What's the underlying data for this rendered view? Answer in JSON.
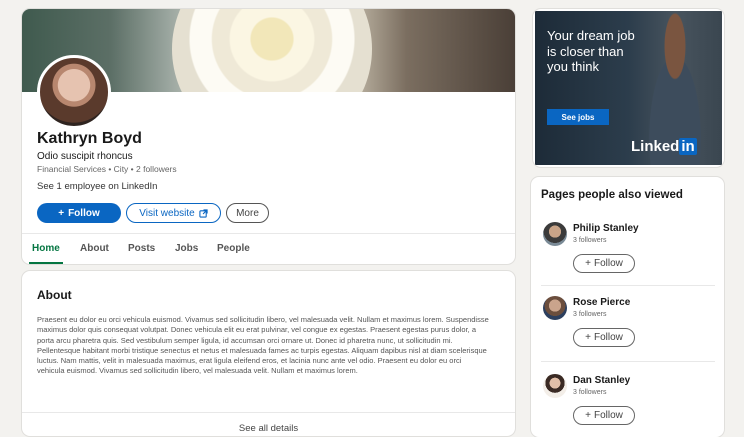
{
  "profile": {
    "name": "Kathryn Boyd",
    "headline": "Odio suscipit rhoncus",
    "meta": "Financial Services • City • 2 followers",
    "employees_link": "See 1 employee on LinkedIn",
    "follow_label": "Follow",
    "website_label": "Visit website",
    "more_label": "More"
  },
  "tabs": [
    {
      "label": "Home",
      "active": true
    },
    {
      "label": "About"
    },
    {
      "label": "Posts"
    },
    {
      "label": "Jobs"
    },
    {
      "label": "People"
    }
  ],
  "about": {
    "title": "About",
    "text": "Praesent eu dolor eu orci vehicula euismod. Vivamus sed sollicitudin libero, vel malesuada velit. Nullam et maximus lorem. Suspendisse maximus dolor quis consequat volutpat. Donec vehicula elit eu erat pulvinar, vel congue ex egestas. Praesent egestas purus dolor, a porta arcu pharetra quis. Sed vestibulum semper ligula, id accumsan orci ornare ut. Donec id pharetra nunc, ut sollicitudin mi. Pellentesque habitant morbi tristique senectus et netus et malesuada fames ac turpis egestas. Aliquam dapibus nisl at diam scelerisque luctus. Nam mattis, velit in malesuada maximus, erat ligula eleifend eros, et lacinia nunc ante vel odio. Praesent eu dolor eu orci vehicula euismod. Vivamus sed sollicitudin libero, vel malesuada velit. Nullam et maximus lorem.",
    "see_all": "See all details"
  },
  "ad": {
    "text": "Your dream job is closer than you think",
    "cta": "See jobs",
    "brand_prefix": "Linked",
    "brand_suffix": "in"
  },
  "also_viewed": {
    "title": "Pages people also viewed",
    "follow_label": "Follow",
    "items": [
      {
        "name": "Philip Stanley",
        "followers": "3 followers"
      },
      {
        "name": "Rose Pierce",
        "followers": "3 followers"
      },
      {
        "name": "Dan Stanley",
        "followers": "3 followers"
      }
    ]
  },
  "colors": {
    "accent": "#0a66c2",
    "active_tab": "#057642"
  }
}
